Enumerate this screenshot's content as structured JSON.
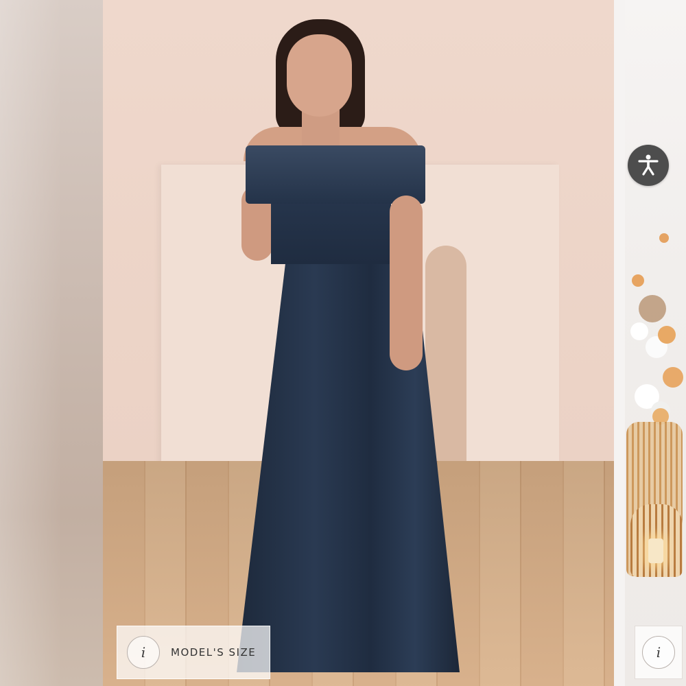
{
  "badges": {
    "model_size": {
      "icon": "info-icon",
      "icon_glyph": "i",
      "label": "MODEL'S SIZE"
    },
    "right_info": {
      "icon": "info-icon",
      "icon_glyph": "i"
    }
  },
  "accessibility": {
    "icon": "accessibility-icon",
    "color": "#4d4d4d"
  },
  "colors": {
    "dress": "#243349",
    "wall": "#ecd5c9",
    "floor": "#d6ad86"
  }
}
